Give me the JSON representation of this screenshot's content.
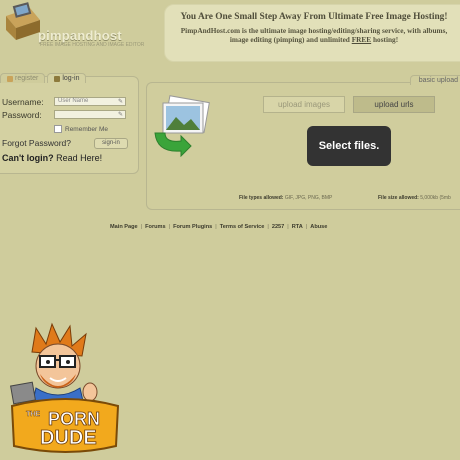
{
  "header": {
    "brand": "pimpandhost",
    "tagline": "FREE IMAGE HOSTING AND IMAGE EDITOR",
    "headline": "You Are One Small Step Away From Ultimate Free Image Hosting!",
    "desc_part1": "PimpAndHost.com is the ultimate image hosting/editing/sharing service, with albums, image editing (pimping) and unlimited",
    "desc_free": "FREE",
    "desc_part2": "hosting!"
  },
  "login": {
    "tab_register": "register",
    "tab_login": "log-in",
    "username_label": "Username:",
    "username_placeholder": "User Name",
    "password_label": "Password:",
    "remember_label": "Remember Me",
    "forgot_label": "Forgot Password?",
    "signin_label": "sign-in",
    "cant_login": "Can't login?",
    "read_here": "Read Here!"
  },
  "upload": {
    "mode_tab": "basic upload",
    "upload_images": "upload images",
    "upload_urls": "upload urls",
    "select_files": "Select files.",
    "types_label": "File types allowed:",
    "types_value": "GIF, JPG, PNG, BMP",
    "size_label": "File size allowed:",
    "size_value": "5,000kb",
    "size_cut": "(5mb"
  },
  "footer": {
    "links": [
      "Main Page",
      "Forums",
      "Forum Plugins",
      "Terms of Service",
      "2257",
      "RTA",
      "Abuse"
    ]
  },
  "badge": {
    "line1": "THE",
    "line2": "PORN",
    "line3": "DUDE"
  },
  "colors": {
    "background": "#cfcc9c",
    "select_button": "#333333",
    "arrow_green": "#3aa43a"
  }
}
